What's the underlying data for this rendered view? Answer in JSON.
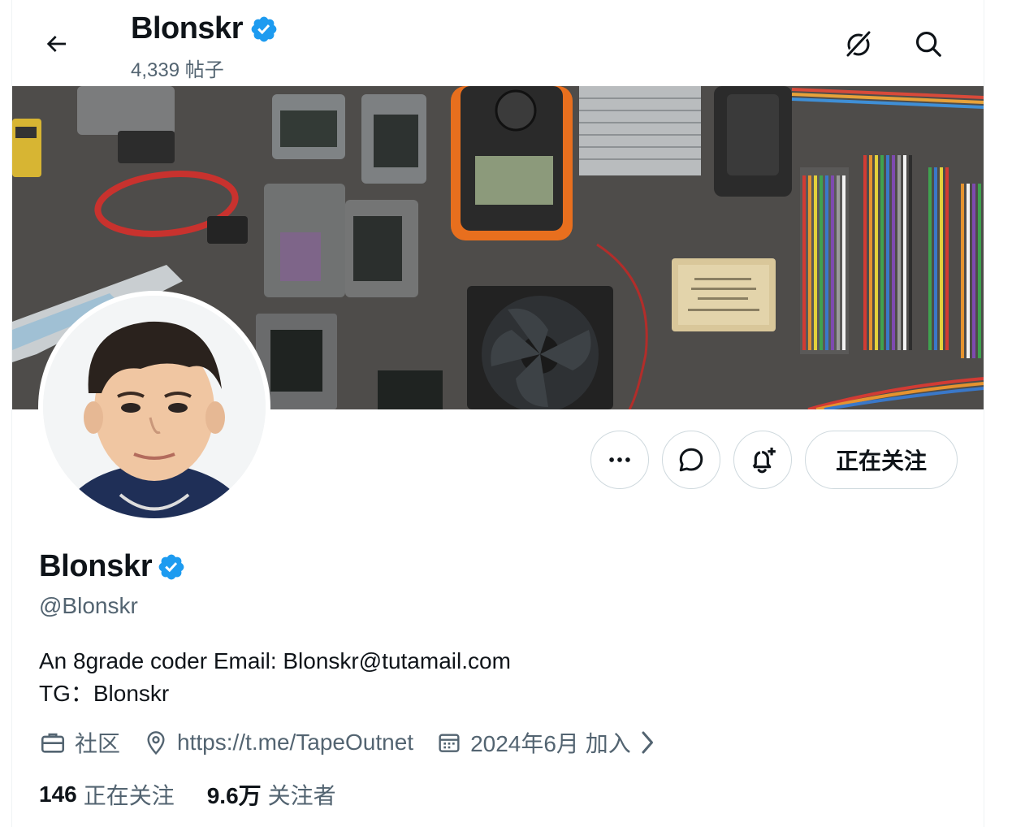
{
  "header": {
    "name": "Blonskr",
    "posts": "4,339 帖子",
    "back_icon": "arrow-left-icon",
    "grok_icon": "grok-icon",
    "search_icon": "search-icon"
  },
  "profile": {
    "name": "Blonskr",
    "handle": "@Blonskr",
    "bio_line1": "An 8grade coder Email: Blonskr@tutamail.com",
    "bio_line2": "TG：Blonskr",
    "category": "社区",
    "website": "https://t.me/TapeOutnet",
    "joined": "2024年6月 加入",
    "verified_color": "#1d9bf0"
  },
  "actions": {
    "more_icon": "more-dots-icon",
    "message_icon": "message-icon",
    "notify_icon": "bell-plus-icon",
    "follow_label": "正在关注"
  },
  "stats": {
    "following_count": "146",
    "following_label": "正在关注",
    "followers_count": "9.6万",
    "followers_label": "关注者"
  },
  "colors": {
    "text_primary": "#0f1419",
    "text_secondary": "#536471",
    "border": "#cfd9de",
    "accent": "#1d9bf0"
  }
}
